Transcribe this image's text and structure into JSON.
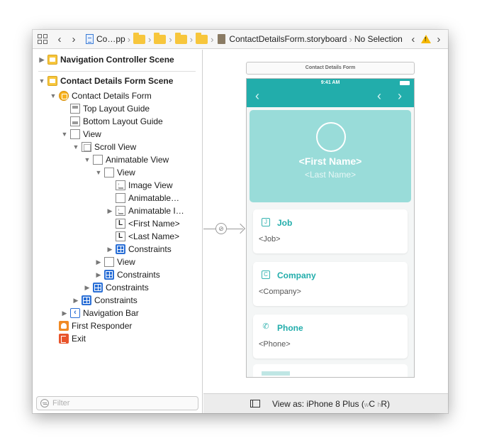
{
  "jumpbar": {
    "project": "Co…pp",
    "file": "ContactDetailsForm.storyboard",
    "selection": "No Selection"
  },
  "outline": {
    "scene1": "Navigation Controller Scene",
    "scene2": "Contact Details Form Scene",
    "items": [
      {
        "label": "Contact Details Form"
      },
      {
        "label": "Top Layout Guide"
      },
      {
        "label": "Bottom Layout Guide"
      },
      {
        "label": "View"
      },
      {
        "label": "Scroll View"
      },
      {
        "label": "Animatable View"
      },
      {
        "label": "View"
      },
      {
        "label": "Image View"
      },
      {
        "label": "Animatable…"
      },
      {
        "label": "Animatable I…"
      },
      {
        "label": "<First Name>"
      },
      {
        "label": "<Last Name>"
      },
      {
        "label": "Constraints"
      },
      {
        "label": "View"
      },
      {
        "label": "Constraints"
      },
      {
        "label": "Constraints"
      },
      {
        "label": "Constraints"
      },
      {
        "label": "Navigation Bar"
      },
      {
        "label": "First Responder"
      },
      {
        "label": "Exit"
      }
    ],
    "filter_placeholder": "Filter"
  },
  "canvas": {
    "vc_title": "Contact Details Form",
    "status_time": "9:41 AM",
    "first_name": "<First Name>",
    "last_name": "<Last Name>",
    "cards": [
      {
        "icon": "J",
        "title": "Job",
        "value": "<Job>"
      },
      {
        "icon": "C",
        "title": "Company",
        "value": "<Company>"
      },
      {
        "icon": "✆",
        "title": "Phone",
        "value": "<Phone>"
      }
    ],
    "view_as_prefix": "View as: iPhone 8 Plus (",
    "size_w": "w",
    "size_w_value": "C ",
    "size_h": "h",
    "size_h_value": "R",
    "view_as_suffix": ")"
  },
  "colors": {
    "accent": "#22adab",
    "header": "#99dcd9",
    "warning": "#f5b800"
  }
}
